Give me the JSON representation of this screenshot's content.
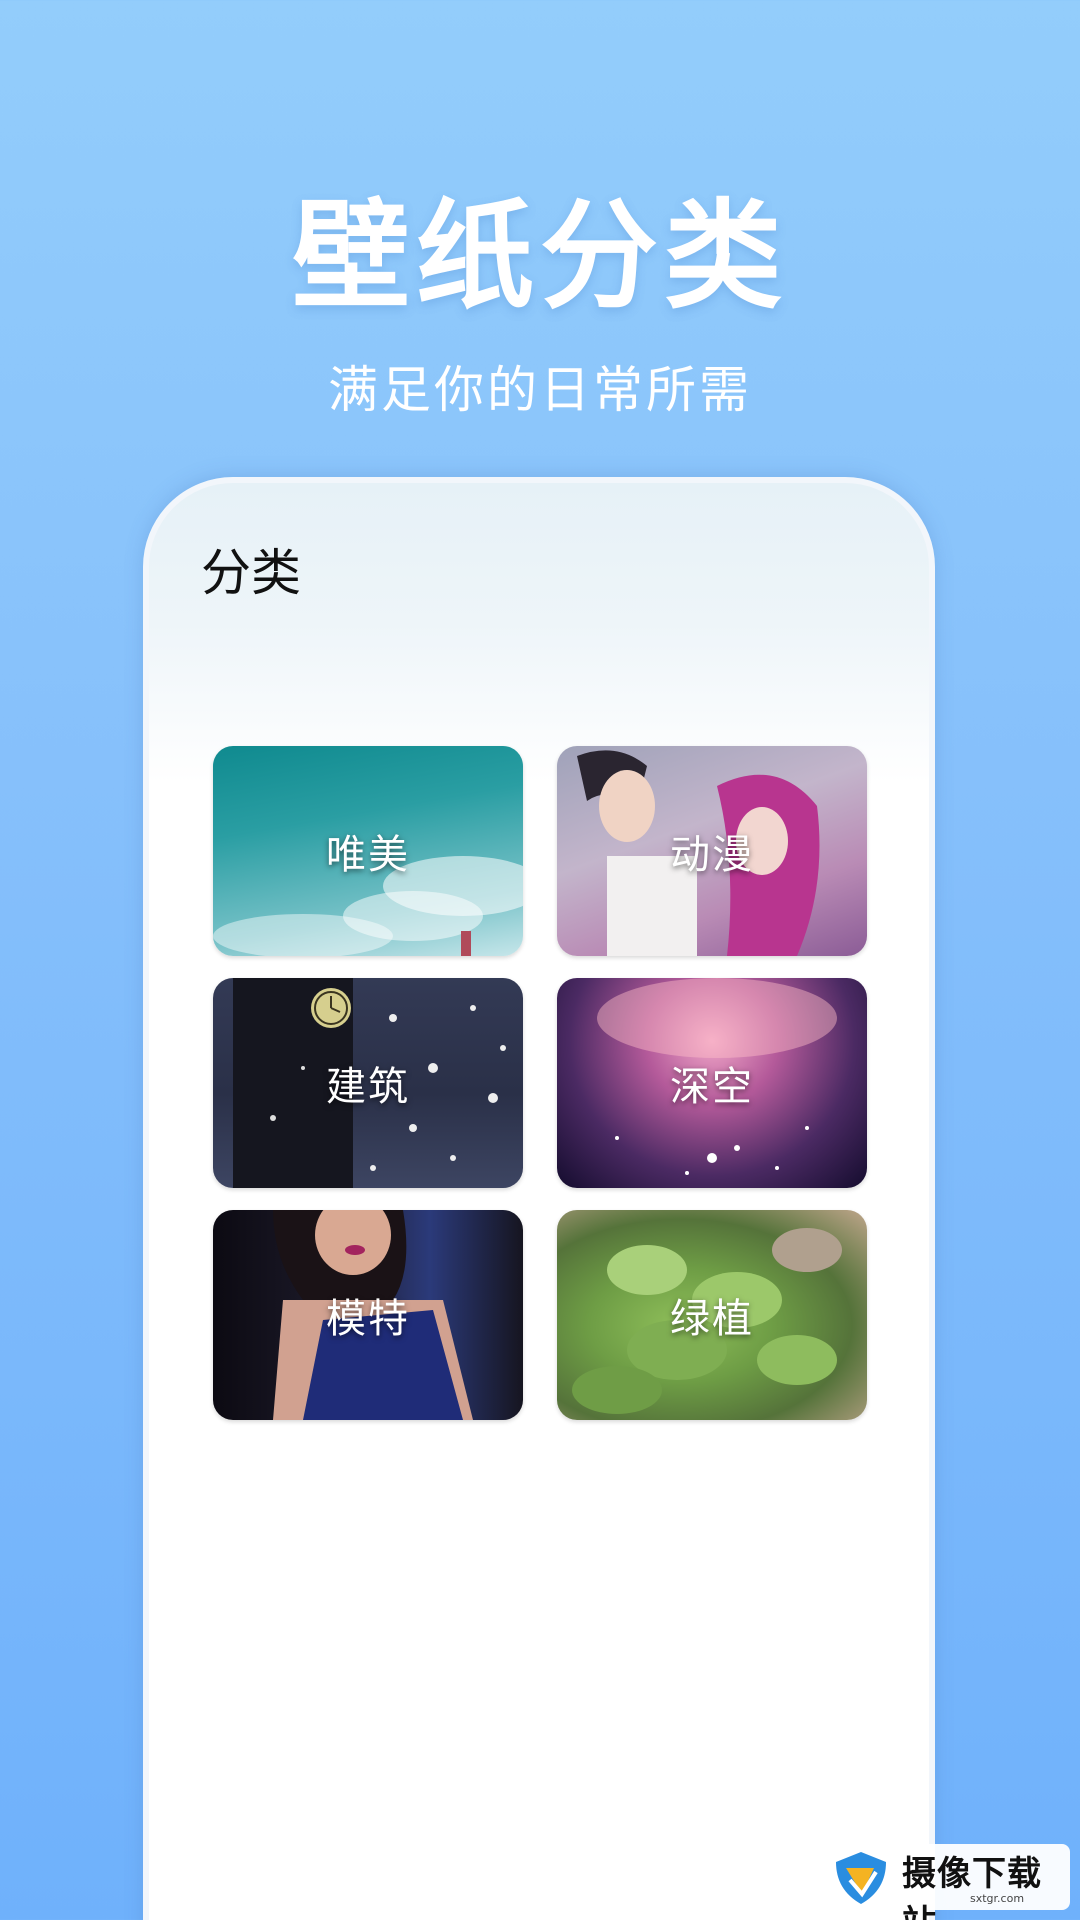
{
  "header": {
    "title": "壁纸分类",
    "subtitle": "满足你的日常所需"
  },
  "phone": {
    "title": "分类",
    "categories": [
      {
        "label": "唯美"
      },
      {
        "label": "动漫"
      },
      {
        "label": "建筑"
      },
      {
        "label": "深空"
      },
      {
        "label": "模特"
      },
      {
        "label": "绿植"
      }
    ]
  },
  "watermark": {
    "name": "摄像下载站",
    "url": "sxtgr.com"
  },
  "colors": {
    "background_top": "#93cdfb",
    "background_bottom": "#6fb1fb",
    "text_light": "#ffffff",
    "text_dark": "#111111"
  }
}
